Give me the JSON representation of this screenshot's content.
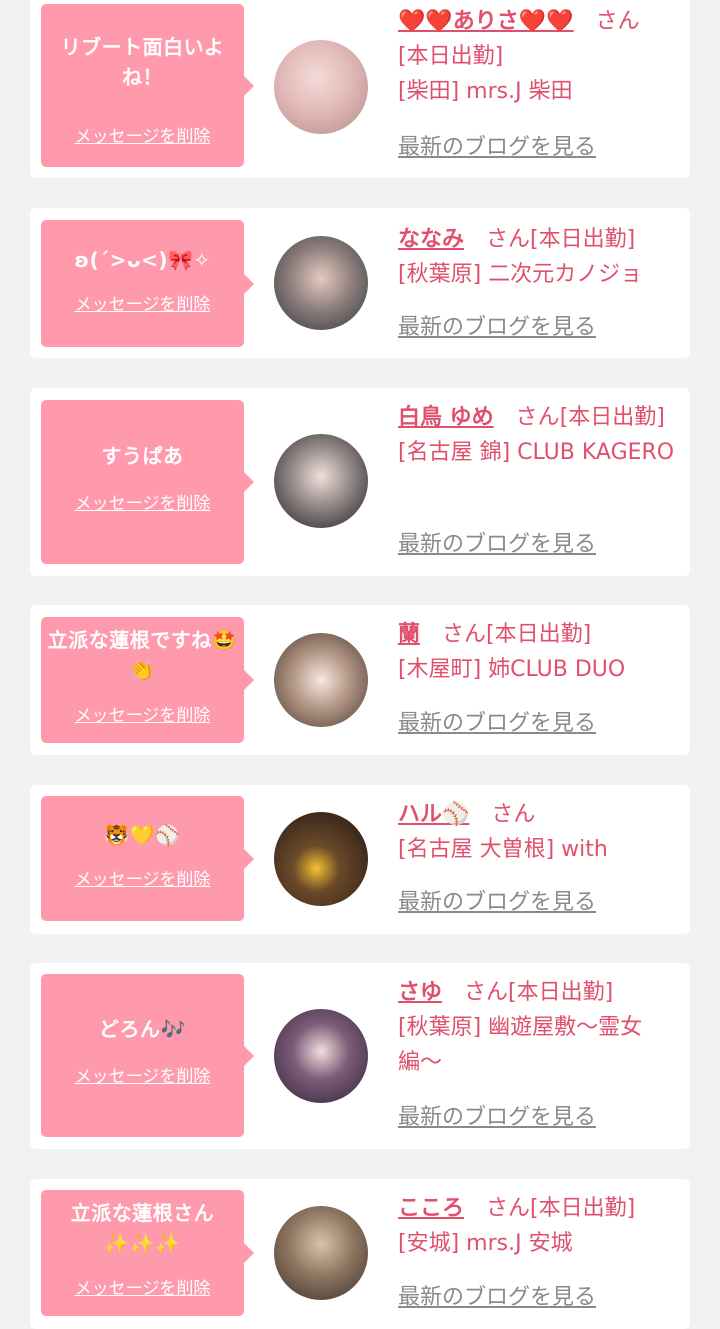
{
  "common": {
    "delete_label": "メッセージを削除",
    "blog_label": "最新のブログを見る",
    "san": "さん"
  },
  "cards": [
    {
      "message": "リブート面白いよね！",
      "name": "❤️❤️ありさ❤️❤️",
      "status": "[本日出勤]",
      "shop": "[柴田] mrs.J 柴田"
    },
    {
      "message": "ʚ(ˊ>ᴗ<)🎀✧",
      "name": "ななみ",
      "status": "[本日出勤]",
      "shop": "[秋葉原] 二次元カノジョ"
    },
    {
      "message": "すうぱあ",
      "name": "白鳥 ゆめ",
      "status": "[本日出勤]",
      "shop": "[名古屋 錦] CLUB KAGERO"
    },
    {
      "message": "立派な蓮根ですね🤩👏",
      "name": "蘭",
      "status": "[本日出勤]",
      "shop": "[木屋町] 姉CLUB DUO"
    },
    {
      "message": "🐯💛⚾",
      "name": "ハル⚾",
      "status": "",
      "shop": "[名古屋 大曽根] with"
    },
    {
      "message": "どろん🎶",
      "name": "さゆ",
      "status": "[本日出勤]",
      "shop": "[秋葉原] 幽遊屋敷〜霊女編〜"
    },
    {
      "message": "立派な蓮根さん✨✨✨",
      "name": "こころ",
      "status": "[本日出勤]",
      "shop": "[安城] mrs.J 安城"
    }
  ],
  "colors": {
    "bubble": "#ff9aac",
    "name": "#e0506c",
    "link_gray": "#8a8a8a",
    "page_bg": "#f2f2f2"
  }
}
